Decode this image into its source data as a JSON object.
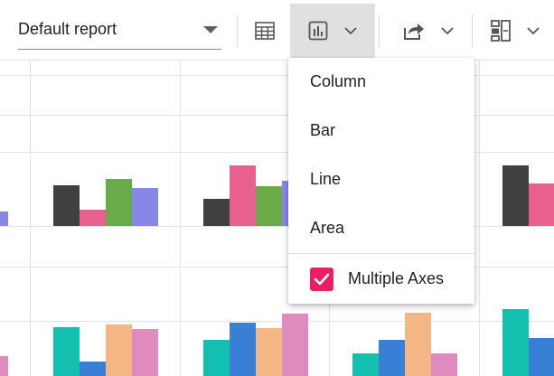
{
  "toolbar": {
    "report_select": {
      "value": "Default report"
    },
    "buttons": [
      {
        "name": "grid-view-button",
        "icon": "table-grid-icon"
      },
      {
        "name": "chart-view-button",
        "icon": "bar-chart-icon",
        "active": true
      },
      {
        "name": "export-button",
        "icon": "share-export-icon"
      },
      {
        "name": "format-button",
        "icon": "conditional-format-icon"
      }
    ]
  },
  "chart_menu": {
    "items": [
      {
        "label": "Column"
      },
      {
        "label": "Bar"
      },
      {
        "label": "Line"
      },
      {
        "label": "Area"
      }
    ],
    "multiple_axes": {
      "label": "Multiple Axes",
      "checked": true
    }
  },
  "colors": {
    "accent": "#e91e63",
    "series_top": [
      "#404040",
      "#e8608f",
      "#6aaa48",
      "#8787e8"
    ],
    "series_bottom": [
      "#13bfae",
      "#3a7fd6",
      "#f5b685",
      "#df8bbd"
    ]
  }
}
